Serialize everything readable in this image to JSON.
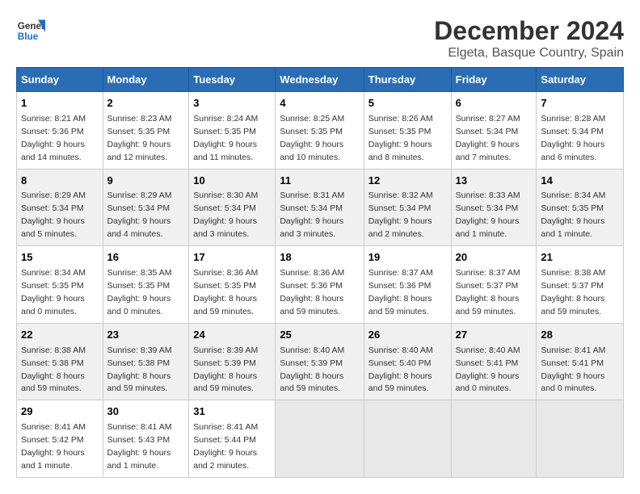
{
  "logo": {
    "line1": "General",
    "line2": "Blue"
  },
  "title": "December 2024",
  "subtitle": "Elgeta, Basque Country, Spain",
  "days_of_week": [
    "Sunday",
    "Monday",
    "Tuesday",
    "Wednesday",
    "Thursday",
    "Friday",
    "Saturday"
  ],
  "weeks": [
    [
      {
        "day": "1",
        "info": "Sunrise: 8:21 AM\nSunset: 5:36 PM\nDaylight: 9 hours and 14 minutes."
      },
      {
        "day": "2",
        "info": "Sunrise: 8:23 AM\nSunset: 5:35 PM\nDaylight: 9 hours and 12 minutes."
      },
      {
        "day": "3",
        "info": "Sunrise: 8:24 AM\nSunset: 5:35 PM\nDaylight: 9 hours and 11 minutes."
      },
      {
        "day": "4",
        "info": "Sunrise: 8:25 AM\nSunset: 5:35 PM\nDaylight: 9 hours and 10 minutes."
      },
      {
        "day": "5",
        "info": "Sunrise: 8:26 AM\nSunset: 5:35 PM\nDaylight: 9 hours and 8 minutes."
      },
      {
        "day": "6",
        "info": "Sunrise: 8:27 AM\nSunset: 5:34 PM\nDaylight: 9 hours and 7 minutes."
      },
      {
        "day": "7",
        "info": "Sunrise: 8:28 AM\nSunset: 5:34 PM\nDaylight: 9 hours and 6 minutes."
      }
    ],
    [
      {
        "day": "8",
        "info": "Sunrise: 8:29 AM\nSunset: 5:34 PM\nDaylight: 9 hours and 5 minutes."
      },
      {
        "day": "9",
        "info": "Sunrise: 8:29 AM\nSunset: 5:34 PM\nDaylight: 9 hours and 4 minutes."
      },
      {
        "day": "10",
        "info": "Sunrise: 8:30 AM\nSunset: 5:34 PM\nDaylight: 9 hours and 3 minutes."
      },
      {
        "day": "11",
        "info": "Sunrise: 8:31 AM\nSunset: 5:34 PM\nDaylight: 9 hours and 3 minutes."
      },
      {
        "day": "12",
        "info": "Sunrise: 8:32 AM\nSunset: 5:34 PM\nDaylight: 9 hours and 2 minutes."
      },
      {
        "day": "13",
        "info": "Sunrise: 8:33 AM\nSunset: 5:34 PM\nDaylight: 9 hours and 1 minute."
      },
      {
        "day": "14",
        "info": "Sunrise: 8:34 AM\nSunset: 5:35 PM\nDaylight: 9 hours and 1 minute."
      }
    ],
    [
      {
        "day": "15",
        "info": "Sunrise: 8:34 AM\nSunset: 5:35 PM\nDaylight: 9 hours and 0 minutes."
      },
      {
        "day": "16",
        "info": "Sunrise: 8:35 AM\nSunset: 5:35 PM\nDaylight: 9 hours and 0 minutes."
      },
      {
        "day": "17",
        "info": "Sunrise: 8:36 AM\nSunset: 5:35 PM\nDaylight: 8 hours and 59 minutes."
      },
      {
        "day": "18",
        "info": "Sunrise: 8:36 AM\nSunset: 5:36 PM\nDaylight: 8 hours and 59 minutes."
      },
      {
        "day": "19",
        "info": "Sunrise: 8:37 AM\nSunset: 5:36 PM\nDaylight: 8 hours and 59 minutes."
      },
      {
        "day": "20",
        "info": "Sunrise: 8:37 AM\nSunset: 5:37 PM\nDaylight: 8 hours and 59 minutes."
      },
      {
        "day": "21",
        "info": "Sunrise: 8:38 AM\nSunset: 5:37 PM\nDaylight: 8 hours and 59 minutes."
      }
    ],
    [
      {
        "day": "22",
        "info": "Sunrise: 8:38 AM\nSunset: 5:38 PM\nDaylight: 8 hours and 59 minutes."
      },
      {
        "day": "23",
        "info": "Sunrise: 8:39 AM\nSunset: 5:38 PM\nDaylight: 8 hours and 59 minutes."
      },
      {
        "day": "24",
        "info": "Sunrise: 8:39 AM\nSunset: 5:39 PM\nDaylight: 8 hours and 59 minutes."
      },
      {
        "day": "25",
        "info": "Sunrise: 8:40 AM\nSunset: 5:39 PM\nDaylight: 8 hours and 59 minutes."
      },
      {
        "day": "26",
        "info": "Sunrise: 8:40 AM\nSunset: 5:40 PM\nDaylight: 8 hours and 59 minutes."
      },
      {
        "day": "27",
        "info": "Sunrise: 8:40 AM\nSunset: 5:41 PM\nDaylight: 9 hours and 0 minutes."
      },
      {
        "day": "28",
        "info": "Sunrise: 8:41 AM\nSunset: 5:41 PM\nDaylight: 9 hours and 0 minutes."
      }
    ],
    [
      {
        "day": "29",
        "info": "Sunrise: 8:41 AM\nSunset: 5:42 PM\nDaylight: 9 hours and 1 minute."
      },
      {
        "day": "30",
        "info": "Sunrise: 8:41 AM\nSunset: 5:43 PM\nDaylight: 9 hours and 1 minute."
      },
      {
        "day": "31",
        "info": "Sunrise: 8:41 AM\nSunset: 5:44 PM\nDaylight: 9 hours and 2 minutes."
      },
      null,
      null,
      null,
      null
    ]
  ]
}
